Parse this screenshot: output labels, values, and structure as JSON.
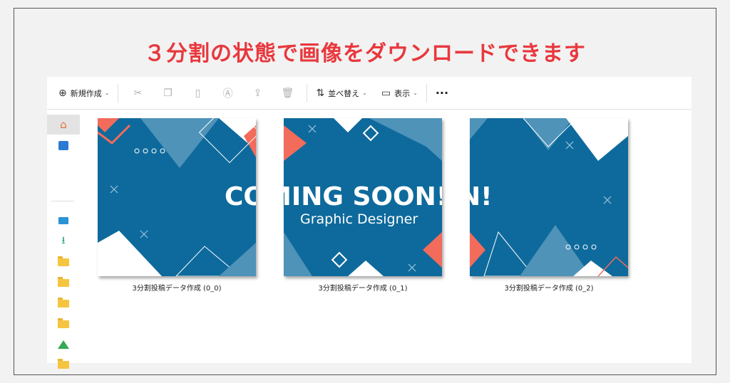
{
  "headline": "３分割の状態で画像をダウンロードできます",
  "toolbar": {
    "new_label": "新規作成",
    "sort_label": "並べ替え",
    "view_label": "表示",
    "more": "···"
  },
  "banner": {
    "title": "COMING SOON!",
    "subtitle": "Graphic Designer"
  },
  "files": [
    {
      "name": "3分割投稿データ作成 (0_0)"
    },
    {
      "name": "3分割投稿データ作成 (0_1)"
    },
    {
      "name": "3分割投稿データ作成 (0_2)"
    }
  ],
  "colors": {
    "headline": "#e8383d",
    "tile_bg": "#0e6a9c",
    "accent": "#f26b5b",
    "light_blue": "#4f93b9"
  },
  "icons": [
    "plus-circle-icon",
    "cut-icon",
    "copy-icon",
    "paste-icon",
    "rename-icon",
    "share-icon",
    "delete-icon",
    "sort-icon",
    "view-icon",
    "more-icon",
    "home-icon",
    "gallery-icon",
    "desktop-icon",
    "download-icon",
    "folder-icon",
    "google-drive-icon"
  ]
}
